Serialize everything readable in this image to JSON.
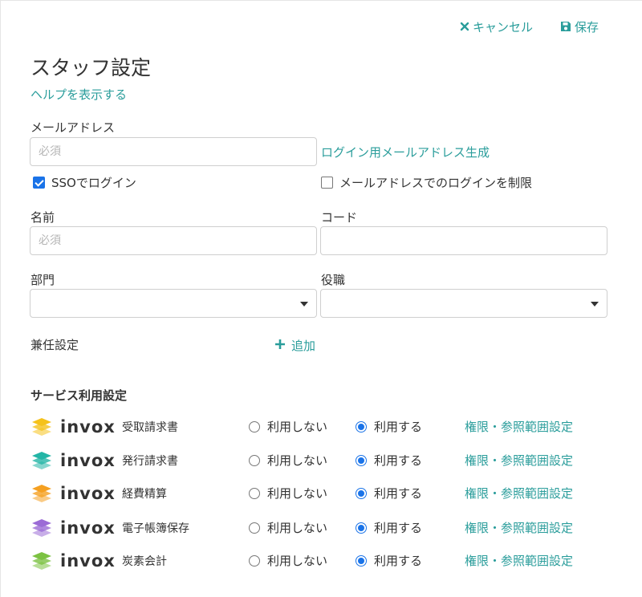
{
  "header": {
    "cancel_label": "キャンセル",
    "save_label": "保存",
    "cancel_icon": "x-icon",
    "save_icon": "floppy-disk-icon"
  },
  "page": {
    "title": "スタッフ設定",
    "help_link": "ヘルプを表示する"
  },
  "email": {
    "label": "メールアドレス",
    "placeholder": "必須",
    "value": "",
    "generate_link": "ログイン用メールアドレス生成"
  },
  "sso": {
    "label": "SSOでログイン",
    "checked": true
  },
  "restrict_email_login": {
    "label": "メールアドレスでのログインを制限",
    "checked": false
  },
  "name": {
    "label": "名前",
    "placeholder": "必須",
    "value": ""
  },
  "code": {
    "label": "コード",
    "value": ""
  },
  "department": {
    "label": "部門",
    "selected": ""
  },
  "position": {
    "label": "役職",
    "selected": ""
  },
  "concurrent": {
    "label": "兼任設定",
    "add_label": "追加"
  },
  "services": {
    "section_title": "サービス利用設定",
    "off_label": "利用しない",
    "on_label": "利用する",
    "perm_label": "権限・参照範囲設定",
    "items": [
      {
        "brand": "invox",
        "product": "受取請求書",
        "icon_color": "#f5c21b",
        "selected": "on"
      },
      {
        "brand": "invox",
        "product": "発行請求書",
        "icon_color": "#23b5a6",
        "selected": "on"
      },
      {
        "brand": "invox",
        "product": "経費精算",
        "icon_color": "#f5a021",
        "selected": "on"
      },
      {
        "brand": "invox",
        "product": "電子帳簿保存",
        "icon_color": "#9b6bd6",
        "selected": "on"
      },
      {
        "brand": "invox",
        "product": "炭素会計",
        "icon_color": "#7cc242",
        "selected": "on"
      }
    ]
  },
  "colors": {
    "accent": "#2a9d9b",
    "radio_selected": "#1a73e8"
  }
}
